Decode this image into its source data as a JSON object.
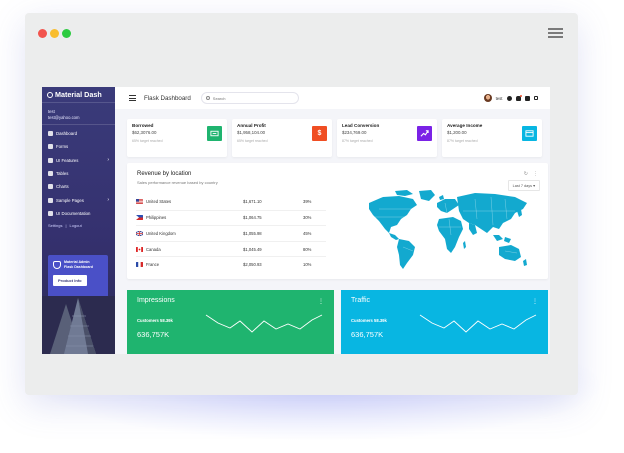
{
  "colors": {
    "accent": "#3a3b7a",
    "green": "#1fb46f",
    "cyan": "#08b6e2",
    "promo": "#4a50c7"
  },
  "window": {
    "menu_icon": "hamburger-menu-icon"
  },
  "sidebar": {
    "brand": "Material Dash",
    "user_name": "test",
    "user_email": "test@yahoo.com",
    "items": [
      {
        "label": "Dashboard",
        "icon": "home-icon"
      },
      {
        "label": "Forms",
        "icon": "forms-icon"
      },
      {
        "label": "UI Features",
        "icon": "features-icon",
        "chevron": "›"
      },
      {
        "label": "Tables",
        "icon": "table-icon"
      },
      {
        "label": "Charts",
        "icon": "chart-icon"
      },
      {
        "label": "Sample Pages",
        "icon": "pages-icon",
        "chevron": "›"
      },
      {
        "label": "UI Documentation",
        "icon": "docs-icon"
      }
    ],
    "links": {
      "settings": "Settings",
      "sep": "|",
      "logout": "Logout"
    },
    "promo": {
      "title": "Material Admin",
      "subtitle": "Flask Dashboard",
      "button": "Product Info"
    }
  },
  "topbar": {
    "title": "Flask Dashboard",
    "search_placeholder": "Search",
    "user": "test"
  },
  "stats": [
    {
      "label": "Borrowed",
      "value": "$62,3076.00",
      "note": "65% target reached",
      "color": "#1fb46f",
      "icon": "dollar-card-icon"
    },
    {
      "label": "Annual Profit",
      "value": "$1,958,104.00",
      "note": "65% target reached",
      "color": "#f04e23",
      "icon": "dollar-icon"
    },
    {
      "label": "Lead Conversion",
      "value": "$234,769.00",
      "note": "87% target reached",
      "color": "#7a22e6",
      "icon": "trending-up-icon"
    },
    {
      "label": "Average Income",
      "value": "$1,200.00",
      "note": "87% target reached",
      "color": "#08b6e2",
      "icon": "card-icon"
    }
  ],
  "revenue": {
    "title": "Revenue by location",
    "subtitle": "Sales performance revenue based by country",
    "range": "Last 7 days ▾",
    "rows": [
      {
        "country": "United States",
        "amount": "$1,671.10",
        "percent": "39%",
        "flag": "us"
      },
      {
        "country": "Philippines",
        "amount": "$1,064.75",
        "percent": "30%",
        "flag": "ph"
      },
      {
        "country": "United Kingdom",
        "amount": "$1,055.98",
        "percent": "45%",
        "flag": "uk"
      },
      {
        "country": "Canada",
        "amount": "$1,045.49",
        "percent": "80%",
        "flag": "ca"
      },
      {
        "country": "France",
        "amount": "$2,050.93",
        "percent": "10%",
        "flag": "fr"
      }
    ]
  },
  "impressions": {
    "title": "Impressions",
    "customers": "Customers 58.39k",
    "value": "636,757K",
    "menu": "⋮"
  },
  "traffic": {
    "title": "Traffic",
    "customers": "Customers 58.39k",
    "value": "636,757K",
    "menu": "⋮"
  }
}
